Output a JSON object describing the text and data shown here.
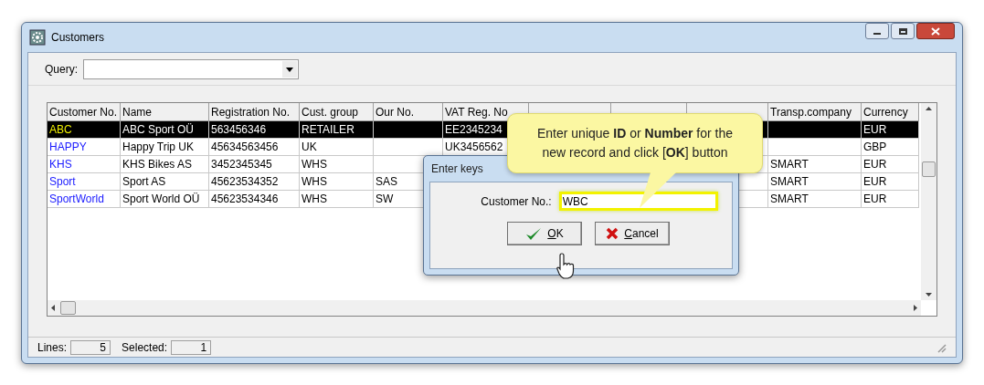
{
  "window": {
    "title": "Customers"
  },
  "query": {
    "label": "Query:"
  },
  "table": {
    "columns": [
      {
        "label": "Customer No."
      },
      {
        "label": "Name"
      },
      {
        "label": "Registration No."
      },
      {
        "label": "Cust. group"
      },
      {
        "label": "Our No."
      },
      {
        "label": "VAT Reg. No"
      },
      {},
      {},
      {},
      {
        "label": "Transp.company"
      },
      {
        "label": "Currency"
      }
    ],
    "rows": [
      {
        "selected": true,
        "cells": [
          "ABC",
          "ABC Sport OÜ",
          "563456346",
          "RETAILER",
          null,
          "EE2345234",
          null,
          null,
          null,
          null,
          "EUR"
        ]
      },
      {
        "selected": false,
        "cells": [
          "HAPPY",
          "Happy Trip UK",
          "45634563456",
          "UK",
          null,
          "UK3456562",
          null,
          null,
          null,
          null,
          "GBP"
        ]
      },
      {
        "selected": false,
        "cells": [
          "KHS",
          "KHS Bikes AS",
          "3452345345",
          "WHS",
          null,
          null,
          null,
          null,
          null,
          "SMART",
          "EUR"
        ]
      },
      {
        "selected": false,
        "cells": [
          "Sport",
          "Sport AS",
          "45623534352",
          "WHS",
          "SAS",
          null,
          null,
          null,
          null,
          "SMART",
          "EUR"
        ]
      },
      {
        "selected": false,
        "cells": [
          "SportWorld",
          "Sport World OÜ",
          "45623534346",
          "WHS",
          "SW",
          null,
          null,
          null,
          null,
          "SMART",
          "EUR"
        ]
      }
    ]
  },
  "status_bar": {
    "lines_label": "Lines:",
    "lines": "5",
    "selected_label": "Selected:",
    "selected": "1"
  },
  "dialog": {
    "title": "Enter keys",
    "field_label": "Customer No.:",
    "value": "WBC",
    "buttons": [
      {
        "kind": "ok",
        "label": "OK"
      },
      {
        "kind": "cancel",
        "label": "Cancel"
      }
    ]
  },
  "callout": {
    "text": "Enter unique **ID** or **Number** for the new record and click [**OK**] button"
  }
}
